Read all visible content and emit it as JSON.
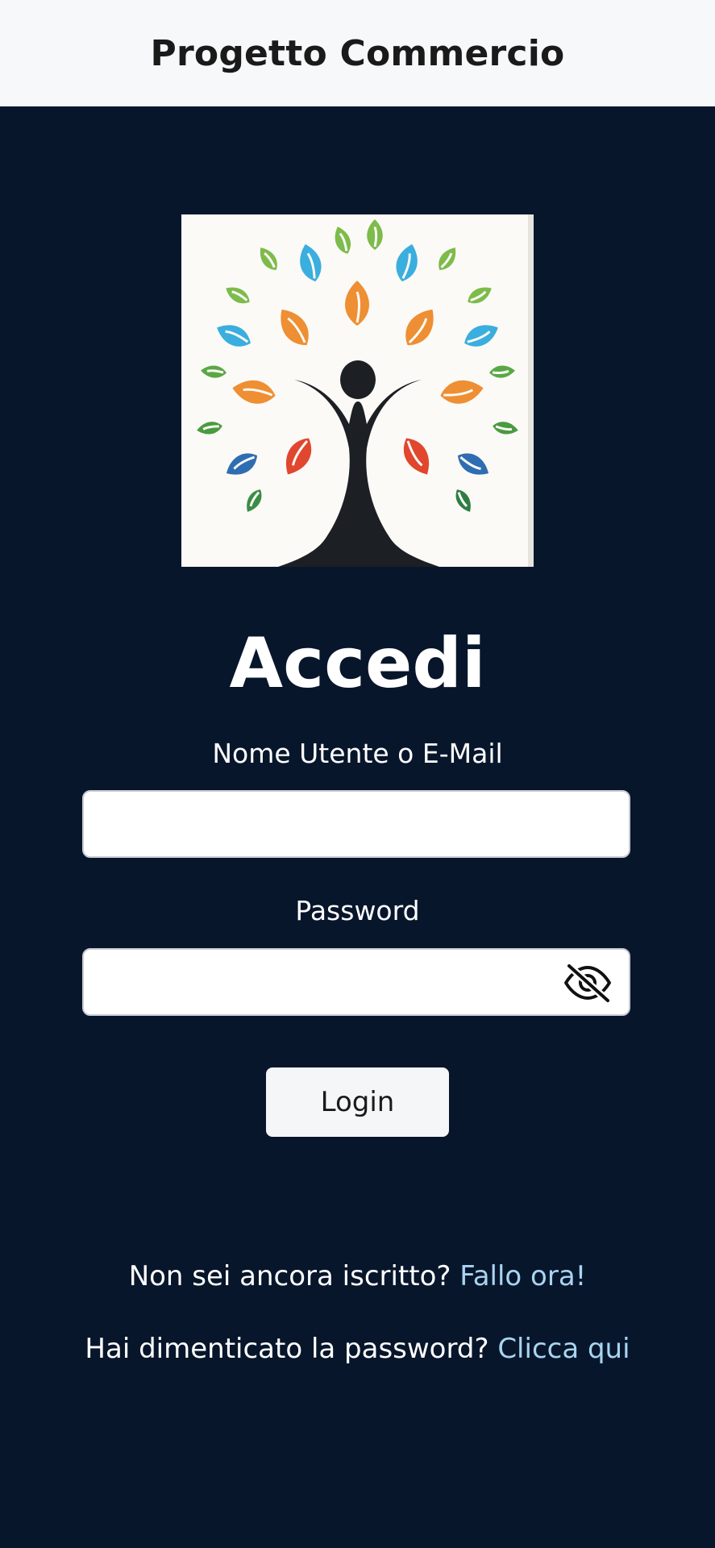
{
  "header": {
    "title": "Progetto Commercio"
  },
  "login": {
    "heading": "Accedi",
    "username_label": "Nome Utente o E-Mail",
    "username_value": "",
    "password_label": "Password",
    "password_value": "",
    "toggle_icon": "eye-slash-icon",
    "submit_label": "Login"
  },
  "signup": {
    "prompt": "Non sei ancora iscritto?",
    "link_text": "Fallo ora!"
  },
  "forgot": {
    "prompt": "Hai dimenticato la password?",
    "link_text": "Clicca qui"
  },
  "colors": {
    "background": "#08162c",
    "header_bg": "#f7f8fa",
    "link": "#a9d4f0"
  }
}
